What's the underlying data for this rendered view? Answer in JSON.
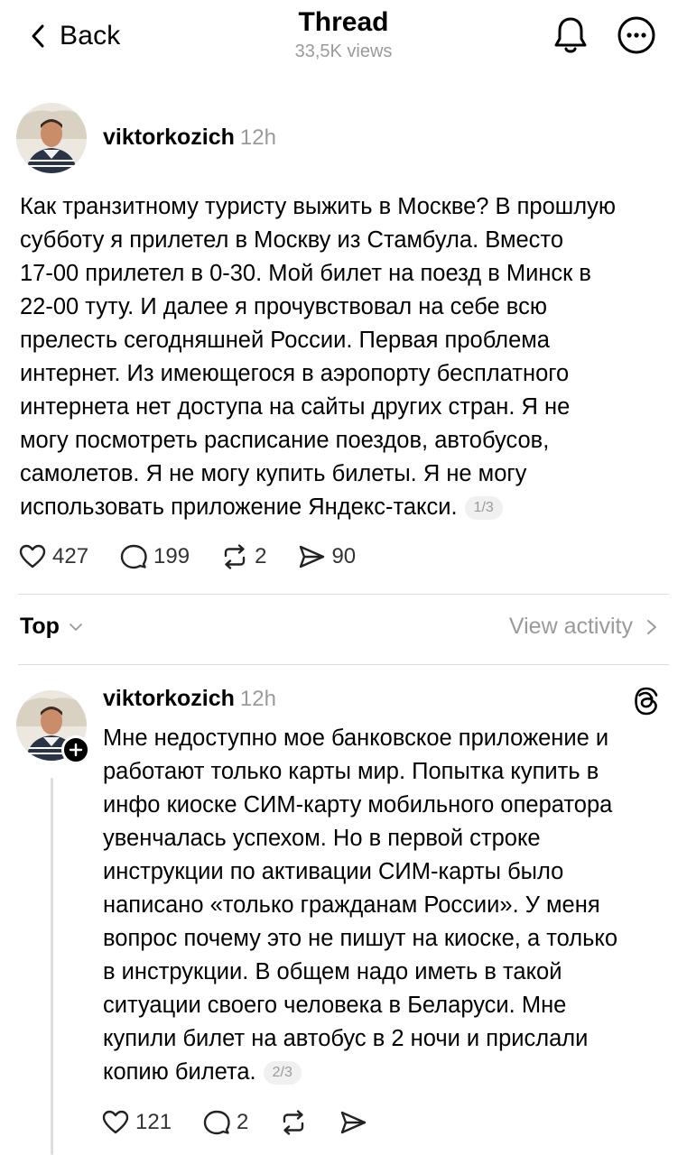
{
  "header": {
    "back_label": "Back",
    "title": "Thread",
    "views": "33,5K views"
  },
  "post1": {
    "username": "viktorkozich",
    "time": "12h",
    "lines": [
      "Как транзитному туристу выжить в Москве? В прошлую",
      "субботу я прилетел в Москву из Стамбула. Вместо",
      "17-00 прилетел в 0-30. Мой билет на поезд в Минск в",
      "22-00 туту. И далее я прочувствовал на себе всю",
      "прелесть сегодняшней России. Первая проблема",
      "интернет. Из имеющегося в аэропорту бесплатного",
      "интернета нет доступа на сайты других стран. Я не",
      "могу посмотреть расписание поездов, автобусов,",
      "самолетов. Я не могу купить билеты. Я не могу",
      "использовать приложение Яндекс-такси."
    ],
    "counter": "1/3",
    "likes": "427",
    "replies": "199",
    "reposts": "2",
    "shares": "90"
  },
  "sort": {
    "label": "Top",
    "view_activity": "View activity"
  },
  "post2": {
    "username": "viktorkozich",
    "time": "12h",
    "lines": [
      "Мне недоступно мое банковское приложение и",
      "работают только карты мир. Попытка купить в",
      "инфо киоске СИМ-карту мобильного оператора",
      "увенчалась успехом. Но в первой строке",
      "инструкции по активации СИМ-карты было",
      "написано «только гражданам России». У меня",
      "вопрос почему это не пишут на киоске, а только",
      "в инструкции. В общем надо иметь в такой",
      "ситуации своего человека в Беларуси. Мне",
      "купили билет на автобус в 2 ночи и прислали",
      "копию билета."
    ],
    "counter": "2/3",
    "likes": "121",
    "replies": "2"
  },
  "icons": {
    "back": "chevron-left-icon",
    "bell": "bell-icon",
    "more": "more-horizontal-icon",
    "like": "heart-icon",
    "reply": "comment-icon",
    "repost": "repost-icon",
    "share": "send-icon",
    "threads": "threads-logo-icon"
  },
  "colors": {
    "text": "#000000",
    "muted": "#9a9a9a",
    "divider": "#dcdcdc"
  }
}
